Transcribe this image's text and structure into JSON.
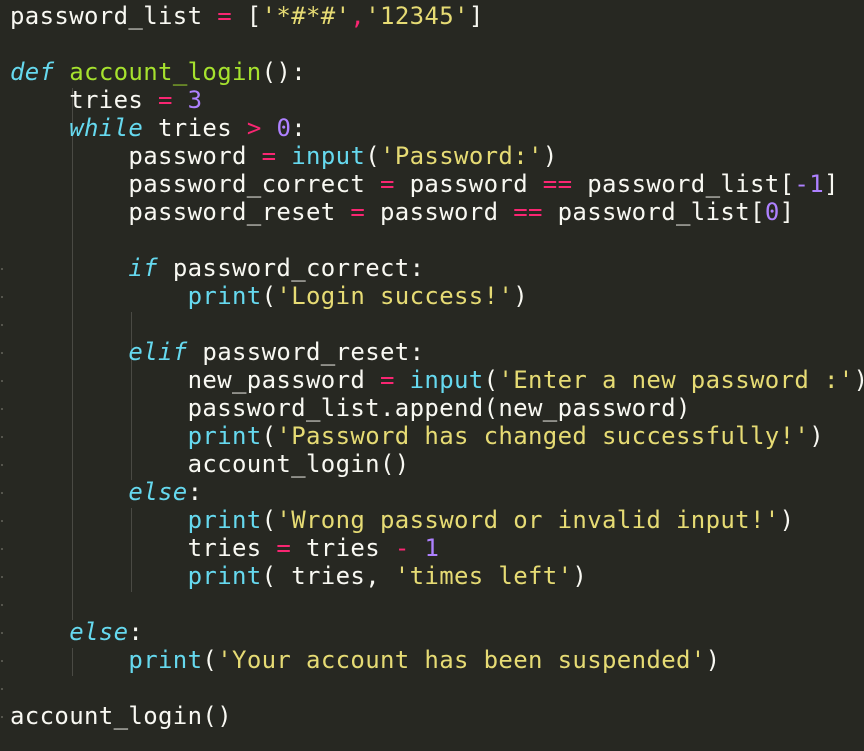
{
  "lines": [
    [
      [
        "password_list",
        "p"
      ],
      [
        " = ",
        "o"
      ],
      [
        "[",
        "p"
      ],
      [
        "'*#*#'",
        "s"
      ],
      [
        ",",
        "o"
      ],
      [
        "'12345'",
        "s"
      ],
      [
        "]",
        "p"
      ]
    ],
    [],
    [
      [
        "def",
        "k"
      ],
      [
        " ",
        "p"
      ],
      [
        "account_login",
        "f"
      ],
      [
        "():",
        "p"
      ]
    ],
    [
      [
        "    tries ",
        "p"
      ],
      [
        "=",
        "o"
      ],
      [
        " ",
        "p"
      ],
      [
        "3",
        "n"
      ]
    ],
    [
      [
        "    ",
        "p"
      ],
      [
        "while",
        "k"
      ],
      [
        " tries ",
        "p"
      ],
      [
        ">",
        "o"
      ],
      [
        " ",
        "p"
      ],
      [
        "0",
        "n"
      ],
      [
        ":",
        "p"
      ]
    ],
    [
      [
        "        password ",
        "p"
      ],
      [
        "=",
        "o"
      ],
      [
        " ",
        "p"
      ],
      [
        "input",
        "b"
      ],
      [
        "(",
        "p"
      ],
      [
        "'Password:'",
        "s"
      ],
      [
        ")",
        "p"
      ]
    ],
    [
      [
        "        password_correct ",
        "p"
      ],
      [
        "=",
        "o"
      ],
      [
        " password ",
        "p"
      ],
      [
        "==",
        "o"
      ],
      [
        " password_list[",
        "p"
      ],
      [
        "-1",
        "n"
      ],
      [
        "]",
        "p"
      ]
    ],
    [
      [
        "        password_reset ",
        "p"
      ],
      [
        "=",
        "o"
      ],
      [
        " password ",
        "p"
      ],
      [
        "==",
        "o"
      ],
      [
        " password_list[",
        "p"
      ],
      [
        "0",
        "n"
      ],
      [
        "]",
        "p"
      ]
    ],
    [],
    [
      [
        "        ",
        "p"
      ],
      [
        "if",
        "k"
      ],
      [
        " password_correct:",
        "p"
      ]
    ],
    [
      [
        "            ",
        "p"
      ],
      [
        "print",
        "b"
      ],
      [
        "(",
        "p"
      ],
      [
        "'Login success!'",
        "s"
      ],
      [
        ")",
        "p"
      ]
    ],
    [],
    [
      [
        "        ",
        "p"
      ],
      [
        "elif",
        "k"
      ],
      [
        " password_reset:",
        "p"
      ]
    ],
    [
      [
        "            new_password ",
        "p"
      ],
      [
        "=",
        "o"
      ],
      [
        " ",
        "p"
      ],
      [
        "input",
        "b"
      ],
      [
        "(",
        "p"
      ],
      [
        "'Enter a new password :'",
        "s"
      ],
      [
        ")",
        "p"
      ]
    ],
    [
      [
        "            password_list.append(new_password)",
        "p"
      ]
    ],
    [
      [
        "            ",
        "p"
      ],
      [
        "print",
        "b"
      ],
      [
        "(",
        "p"
      ],
      [
        "'Password has changed successfully!'",
        "s"
      ],
      [
        ")",
        "p"
      ]
    ],
    [
      [
        "            account_login()",
        "p"
      ]
    ],
    [
      [
        "        ",
        "p"
      ],
      [
        "else",
        "k"
      ],
      [
        ":",
        "p"
      ]
    ],
    [
      [
        "            ",
        "p"
      ],
      [
        "print",
        "b"
      ],
      [
        "(",
        "p"
      ],
      [
        "'Wrong password or invalid input!'",
        "s"
      ],
      [
        ")",
        "p"
      ]
    ],
    [
      [
        "            tries ",
        "p"
      ],
      [
        "=",
        "o"
      ],
      [
        " tries ",
        "p"
      ],
      [
        "-",
        "o"
      ],
      [
        " ",
        "p"
      ],
      [
        "1",
        "n"
      ]
    ],
    [
      [
        "            ",
        "p"
      ],
      [
        "print",
        "b"
      ],
      [
        "( tries, ",
        "p"
      ],
      [
        "'times left'",
        "s"
      ],
      [
        ")",
        "p"
      ]
    ],
    [],
    [
      [
        "    ",
        "p"
      ],
      [
        "else",
        "k"
      ],
      [
        ":",
        "p"
      ]
    ],
    [
      [
        "        ",
        "p"
      ],
      [
        "print",
        "b"
      ],
      [
        "(",
        "p"
      ],
      [
        "'Your account has been suspended'",
        "s"
      ],
      [
        ")",
        "p"
      ]
    ],
    [],
    [
      [
        "account_login()",
        "p"
      ]
    ]
  ]
}
